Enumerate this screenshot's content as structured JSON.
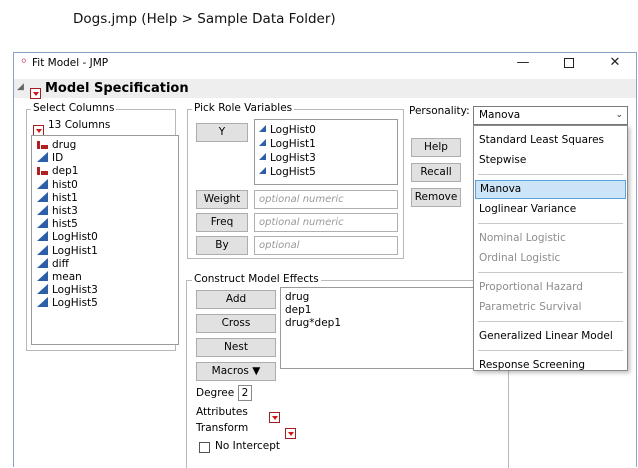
{
  "caption": "Dogs.jmp (Help > Sample Data Folder)",
  "window": {
    "title": "Fit Model - JMP",
    "minimize": "—",
    "maximize": "☐",
    "close": "✕"
  },
  "outline_title": "Model Specification",
  "select_columns": {
    "label": "Select Columns",
    "count": "13 Columns",
    "columns": [
      {
        "name": "drug",
        "type": "nominal"
      },
      {
        "name": "ID",
        "type": "continuous"
      },
      {
        "name": "dep1",
        "type": "nominal"
      },
      {
        "name": "hist0",
        "type": "continuous"
      },
      {
        "name": "hist1",
        "type": "continuous"
      },
      {
        "name": "hist3",
        "type": "continuous"
      },
      {
        "name": "hist5",
        "type": "continuous"
      },
      {
        "name": "LogHist0",
        "type": "continuous"
      },
      {
        "name": "LogHist1",
        "type": "continuous"
      },
      {
        "name": "diff",
        "type": "continuous"
      },
      {
        "name": "mean",
        "type": "continuous"
      },
      {
        "name": "LogHist3",
        "type": "continuous"
      },
      {
        "name": "LogHist5",
        "type": "continuous"
      }
    ]
  },
  "pick_roles": {
    "label": "Pick Role Variables",
    "y_button": "Y",
    "y_values": [
      "LogHist0",
      "LogHist1",
      "LogHist3",
      "LogHist5"
    ],
    "weight_button": "Weight",
    "weight_placeholder": "optional numeric",
    "freq_button": "Freq",
    "freq_placeholder": "optional numeric",
    "by_button": "By",
    "by_placeholder": "optional"
  },
  "actions": {
    "help": "Help",
    "recall": "Recall",
    "remove": "Remove"
  },
  "personality": {
    "label": "Personality:",
    "selected": "Manova",
    "options": [
      {
        "label": "Standard Least Squares",
        "enabled": true,
        "selected": false
      },
      {
        "label": "Stepwise",
        "enabled": true,
        "selected": false
      },
      {
        "label": "Manova",
        "enabled": true,
        "selected": true
      },
      {
        "label": "Loglinear Variance",
        "enabled": true,
        "selected": false
      },
      {
        "label": "Nominal Logistic",
        "enabled": false,
        "selected": false
      },
      {
        "label": "Ordinal Logistic",
        "enabled": false,
        "selected": false
      },
      {
        "label": "Proportional Hazard",
        "enabled": false,
        "selected": false
      },
      {
        "label": "Parametric Survival",
        "enabled": false,
        "selected": false
      },
      {
        "label": "Generalized Linear Model",
        "enabled": true,
        "selected": false
      },
      {
        "label": "Response Screening",
        "enabled": true,
        "selected": false
      }
    ]
  },
  "construct": {
    "label": "Construct Model Effects",
    "add": "Add",
    "cross": "Cross",
    "nest": "Nest",
    "macros": "Macros ▼",
    "effects": [
      "drug",
      "dep1",
      "drug*dep1"
    ],
    "degree_label": "Degree",
    "degree_value": "2",
    "attributes_label": "Attributes",
    "transform_label": "Transform",
    "no_intercept_label": "No Intercept"
  },
  "colors": {
    "accent_red": "#d01818",
    "continuous_blue": "#2d5fa8",
    "nominal_red": "#b02020",
    "selection": "#cce4f7"
  }
}
